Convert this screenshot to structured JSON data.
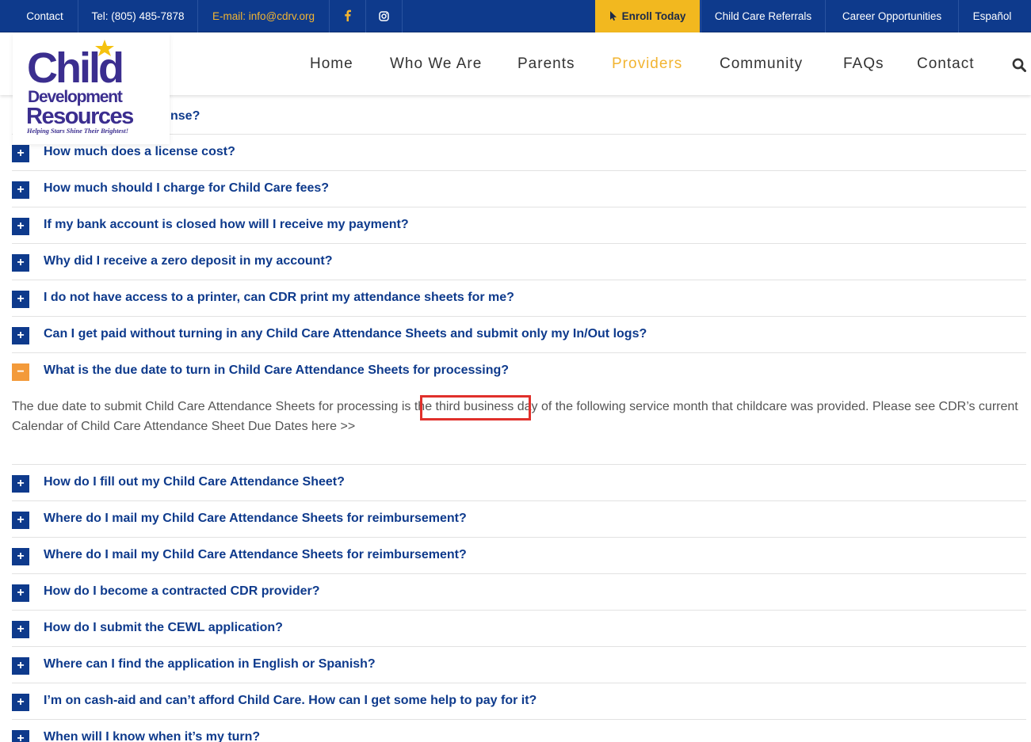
{
  "topbar": {
    "contact": "Contact",
    "tel": "Tel: (805) 485-7878",
    "email": "E-mail: info@cdrv.org",
    "facebook_icon": "facebook-icon",
    "instagram_icon": "instagram-icon",
    "enroll": "Enroll Today",
    "referrals": "Child Care Referrals",
    "careers": "Career Opportunities",
    "espanol": "Español"
  },
  "logo": {
    "line1": "Child",
    "line2": "Development",
    "line3": "Resources",
    "tagline": "Helping Stars Shine Their Brightest!"
  },
  "nav": {
    "home": "Home",
    "who": "Who We Are",
    "parents": "Parents",
    "providers": "Providers",
    "community": "Community",
    "faqs": "FAQs",
    "contact": "Contact"
  },
  "colors": {
    "primary": "#0e3a8c",
    "accent": "#f2b431",
    "open_toggle": "#f39a3a",
    "highlight": "#e0302b"
  },
  "faq": {
    "partial": "nse?",
    "items": [
      "How much does a license cost?",
      "How much should I charge for Child Care fees?",
      "If my bank account is closed how will I receive my payment?",
      "Why did I receive a zero deposit in my account?",
      "I do not have access to a printer, can CDR print my attendance sheets for me?",
      "Can I get paid without turning in any Child Care Attendance Sheets and submit only my In/Out logs?",
      "What is the due date to turn in Child Care Attendance Sheets for processing?",
      "How do I fill out my Child Care Attendance Sheet?",
      "Where do I mail my Child Care Attendance Sheets for reimbursement?",
      "Where do I mail my Child Care Attendance Sheets for reimbursement?",
      "How do I become a contracted CDR provider?",
      "How do I submit the CEWL application?",
      "Where can I find the application in English or Spanish?",
      "I’m on cash-aid and can’t afford Child Care. How can I get some help to pay for it?",
      "When will I know when it’s my turn?"
    ],
    "toggle_plus": "+",
    "toggle_minus": "−",
    "answer": "The due date to submit Child Care Attendance Sheets for processing is the third business day of the following service month that childcare was provided. Please see CDR’s current Calendar of Child Care Attendance Sheet Due Dates here >>"
  }
}
